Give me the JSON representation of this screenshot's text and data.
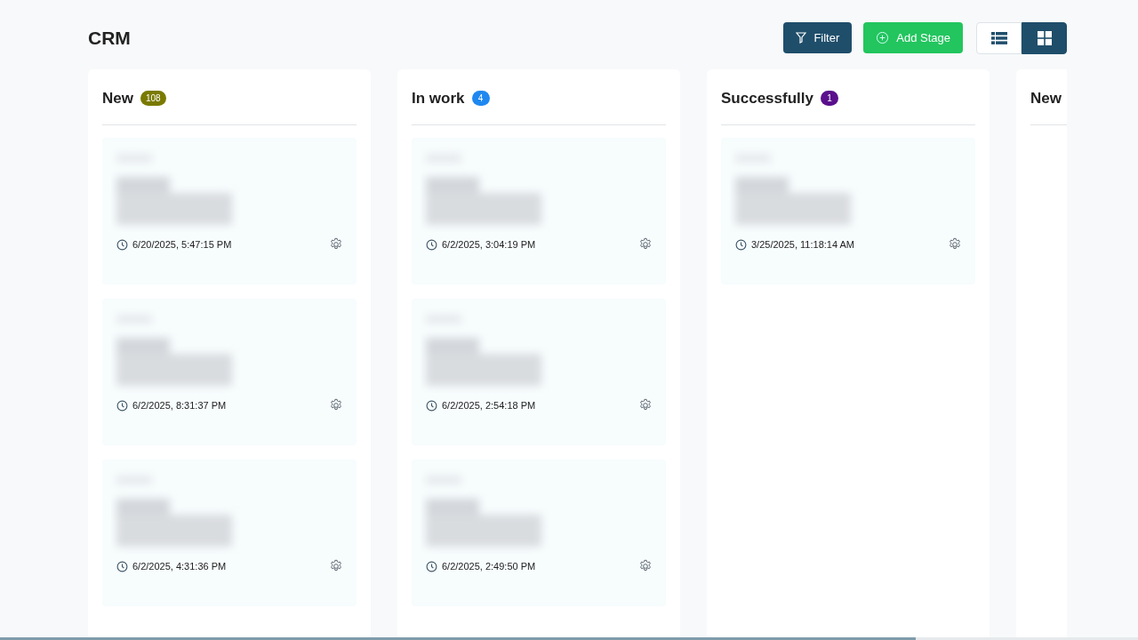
{
  "title": "CRM",
  "toolbar": {
    "filter": "Filter",
    "add_stage": "Add Stage",
    "views": [
      {
        "kind": "list",
        "selected": false
      },
      {
        "kind": "grid",
        "selected": true
      }
    ]
  },
  "stages": [
    {
      "title": "New",
      "count": "108",
      "color": "#7a7a00",
      "cards": [
        {
          "date": "6/20/2025, 5:47:15 PM"
        },
        {
          "date": "6/2/2025, 8:31:37 PM"
        },
        {
          "date": "6/2/2025, 4:31:36 PM"
        }
      ]
    },
    {
      "title": "In work",
      "count": "4",
      "color": "#1e88f0",
      "cards": [
        {
          "date": "6/2/2025, 3:04:19 PM"
        },
        {
          "date": "6/2/2025, 2:54:18 PM"
        },
        {
          "date": "6/2/2025, 2:49:50 PM"
        }
      ]
    },
    {
      "title": "Successfully",
      "count": "1",
      "color": "#5a0f8c",
      "cards": [
        {
          "date": "3/25/2025, 11:18:14 AM"
        }
      ]
    },
    {
      "title": "New"
    }
  ]
}
